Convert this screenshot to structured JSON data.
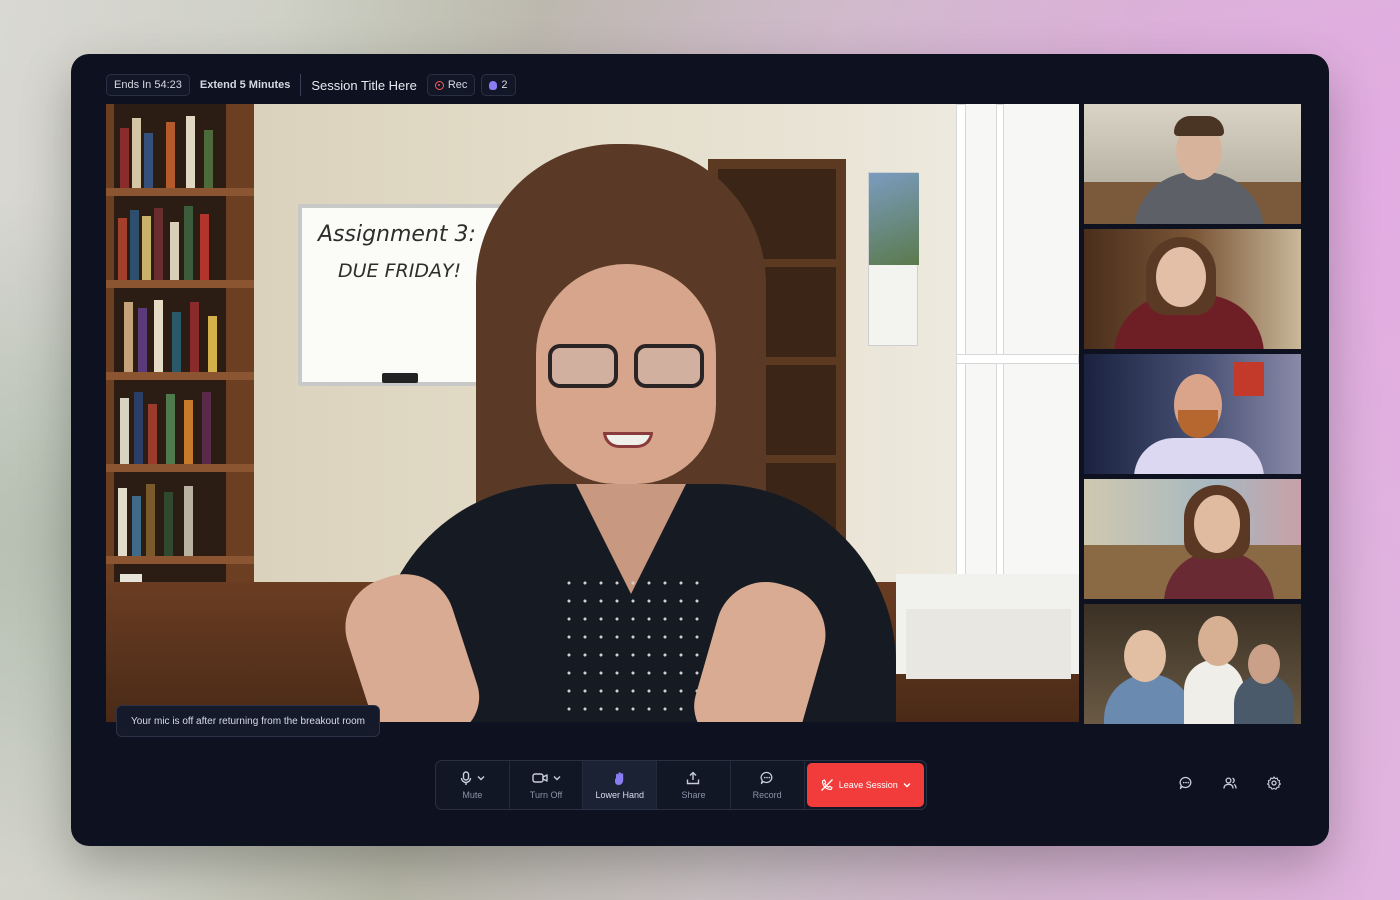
{
  "topbar": {
    "timer": "Ends In 54:23",
    "extend": "Extend 5 Minutes",
    "session_title": "Session Title Here",
    "rec_label": "Rec",
    "hands_count": "2"
  },
  "main_video": {
    "whiteboard_line1": "Assignment 3:",
    "whiteboard_line2": "DUE FRIDAY!"
  },
  "toast": {
    "message": "Your mic is off after returning from the breakout room"
  },
  "controls": {
    "mute": "Mute",
    "turn_off": "Turn Off",
    "lower_hand": "Lower Hand",
    "share": "Share",
    "record": "Record",
    "leave": "Leave Session"
  },
  "participants_count": 5,
  "colors": {
    "window_bg": "#0e1220",
    "leave_red": "#f23b3b",
    "hand_purple": "#8a7df2",
    "rec_red": "#ff5a5a"
  },
  "icons": [
    "rec-icon",
    "hand-icon",
    "mic-icon",
    "camera-icon",
    "chevron-down-icon",
    "share-icon",
    "record-icon",
    "phone-off-icon",
    "chat-icon",
    "people-icon",
    "gear-icon"
  ]
}
